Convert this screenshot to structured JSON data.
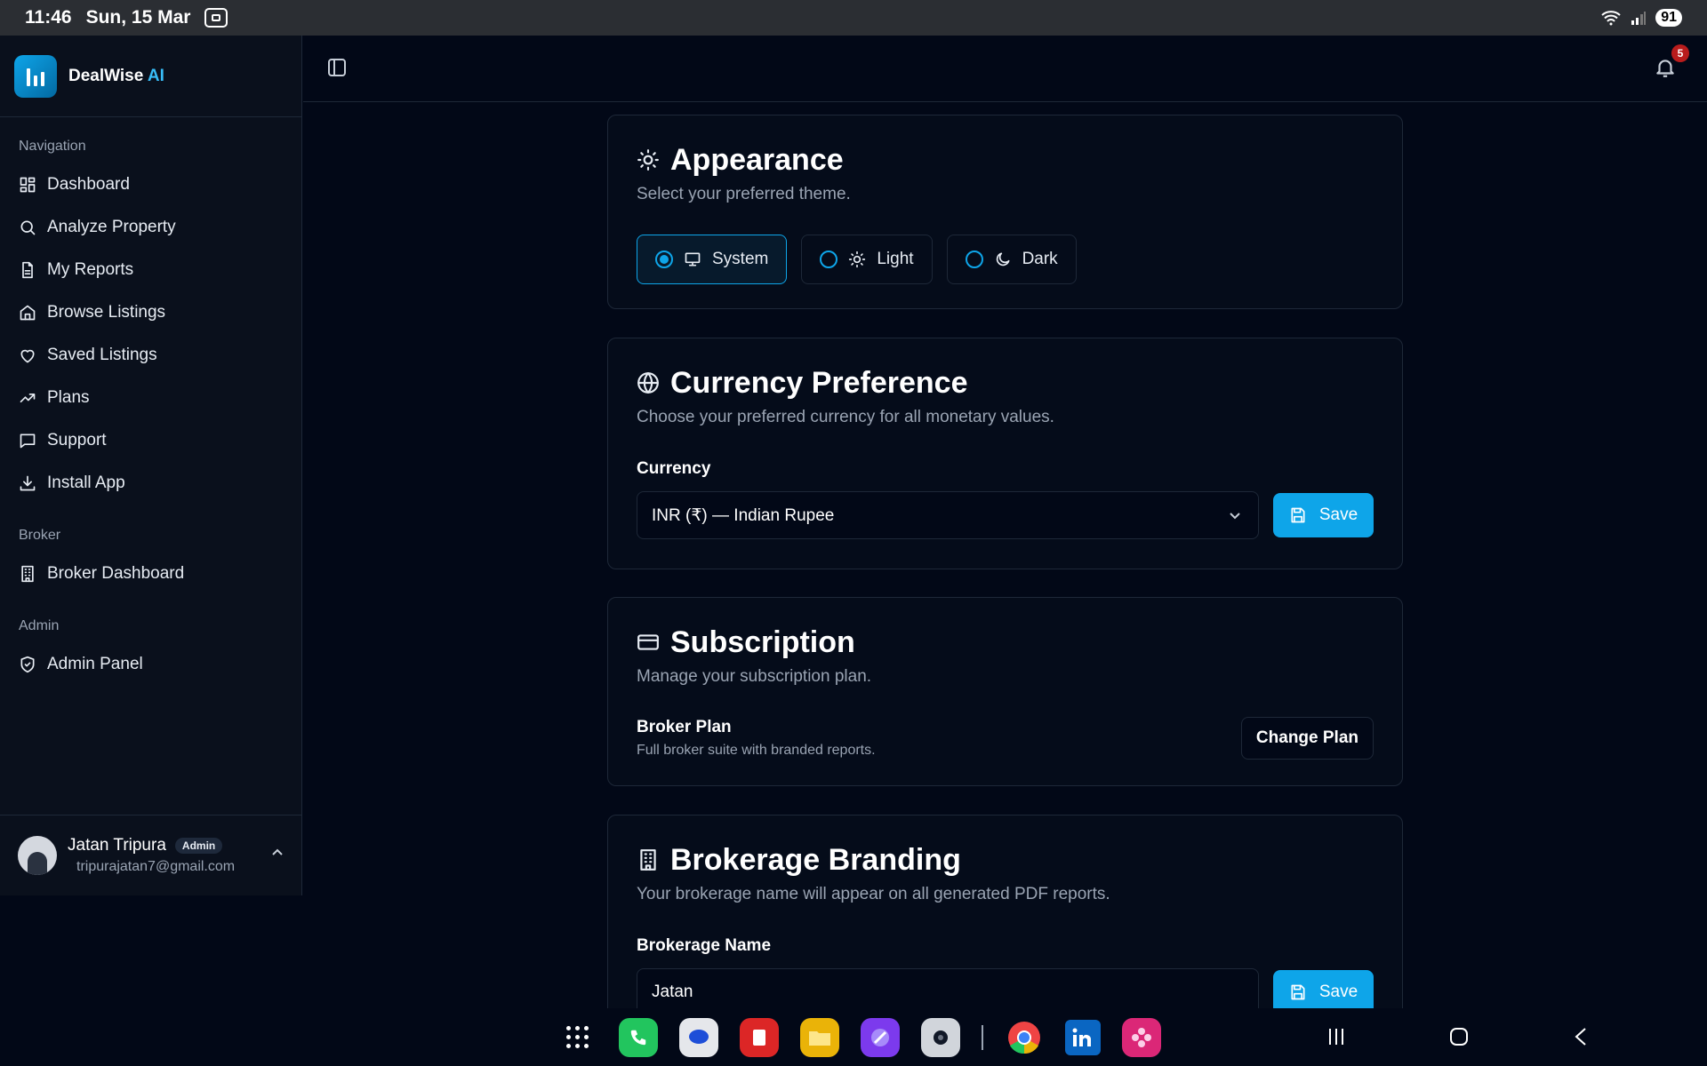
{
  "status_bar": {
    "time": "11:46",
    "date": "Sun, 15 Mar",
    "battery": "91"
  },
  "sidebar": {
    "brand": {
      "name": "DealWise",
      "suffix": "AI"
    },
    "groups": [
      {
        "label": "Navigation",
        "items": [
          {
            "label": "Dashboard",
            "icon": "dashboard-icon"
          },
          {
            "label": "Analyze Property",
            "icon": "search-icon"
          },
          {
            "label": "My Reports",
            "icon": "document-icon"
          },
          {
            "label": "Browse Listings",
            "icon": "home-icon"
          },
          {
            "label": "Saved Listings",
            "icon": "heart-icon"
          },
          {
            "label": "Plans",
            "icon": "trending-up-icon"
          },
          {
            "label": "Support",
            "icon": "message-icon"
          },
          {
            "label": "Install App",
            "icon": "download-icon"
          }
        ]
      },
      {
        "label": "Broker",
        "items": [
          {
            "label": "Broker Dashboard",
            "icon": "building-icon"
          }
        ]
      },
      {
        "label": "Admin",
        "items": [
          {
            "label": "Admin Panel",
            "icon": "shield-icon"
          }
        ]
      }
    ],
    "user": {
      "name": "Jatan Tripura",
      "role_badge": "Admin",
      "email": "tripurajatan7@gmail.com"
    }
  },
  "topbar": {
    "notification_count": "5"
  },
  "appearance": {
    "title": "Appearance",
    "subtitle": "Select your preferred theme.",
    "options": [
      {
        "label": "System",
        "selected": true
      },
      {
        "label": "Light",
        "selected": false
      },
      {
        "label": "Dark",
        "selected": false
      }
    ]
  },
  "currency": {
    "title": "Currency Preference",
    "subtitle": "Choose your preferred currency for all monetary values.",
    "field_label": "Currency",
    "value": "INR (₹) — Indian Rupee",
    "save_label": "Save"
  },
  "subscription": {
    "title": "Subscription",
    "subtitle": "Manage your subscription plan.",
    "plan_name": "Broker Plan",
    "plan_desc": "Full broker suite with branded reports.",
    "change_label": "Change Plan"
  },
  "branding": {
    "title": "Brokerage Branding",
    "subtitle": "Your brokerage name will appear on all generated PDF reports.",
    "field_label": "Brokerage Name",
    "value": "Jatan",
    "save_label": "Save"
  },
  "colors": {
    "accent": "#0ea5e9",
    "background": "#020817",
    "card": "#050c1a"
  }
}
